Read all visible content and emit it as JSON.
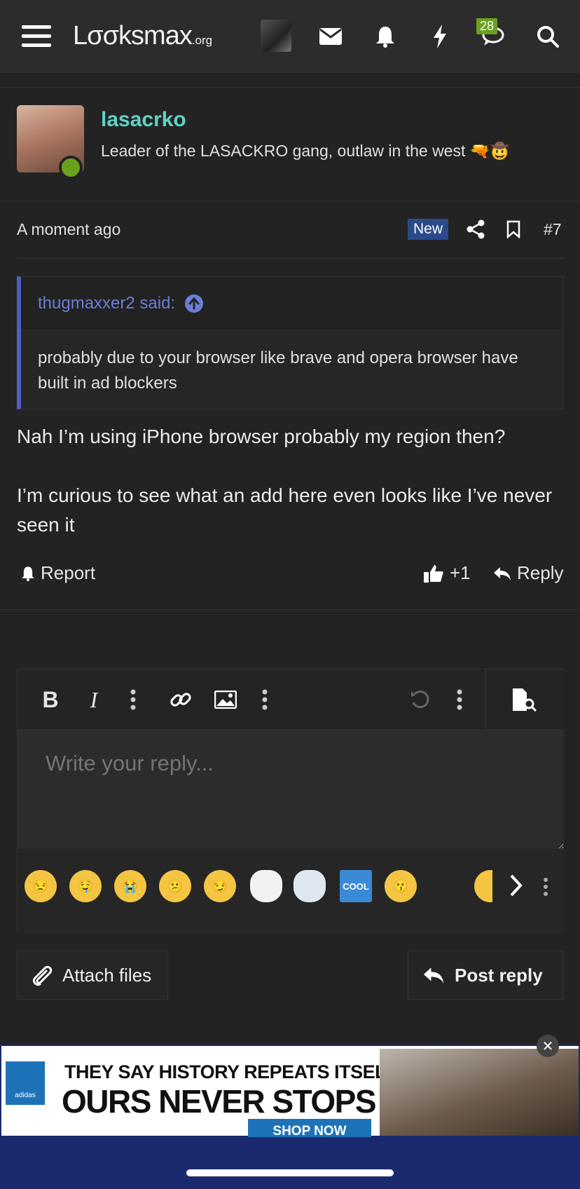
{
  "header": {
    "logo_main": "Lσσksmax",
    "logo_suffix": ".org",
    "conversations_badge": "28"
  },
  "post": {
    "username": "lasacrko",
    "user_title": "Leader of the LASACKRO gang, outlaw in the west 🔫🤠",
    "time": "A moment ago",
    "new_badge": "New",
    "post_number": "#7",
    "quote": {
      "author": "thugmaxxer2 said:",
      "text": "probably due to your browser like brave and opera browser have built in ad blockers"
    },
    "message_p1": "Nah I’m using iPhone browser probably my region then?",
    "message_p2": "I’m curious to see what an add here even looks like I’ve never seen it",
    "report_label": "Report",
    "reaction_count": "+1",
    "reply_label": "Reply"
  },
  "editor": {
    "placeholder": "Write your reply...",
    "smilies": [
      "😒",
      "🤤",
      "😭",
      "😕",
      "😏",
      "wojak",
      "crying-wojak",
      "COOL",
      "😗",
      "😬"
    ],
    "attach_label": "Attach files",
    "post_reply_label": "Post reply"
  },
  "ad": {
    "brand": "adidas",
    "line1": "THEY SAY HISTORY REPEATS ITSELF",
    "line2": "OURS NEVER STOPS",
    "cta": "SHOP NOW"
  },
  "colors": {
    "username": "#5fd3c4",
    "quote_accent": "#4e5fc2",
    "online": "#6aa01e",
    "new_badge": "#2a4a8a"
  }
}
